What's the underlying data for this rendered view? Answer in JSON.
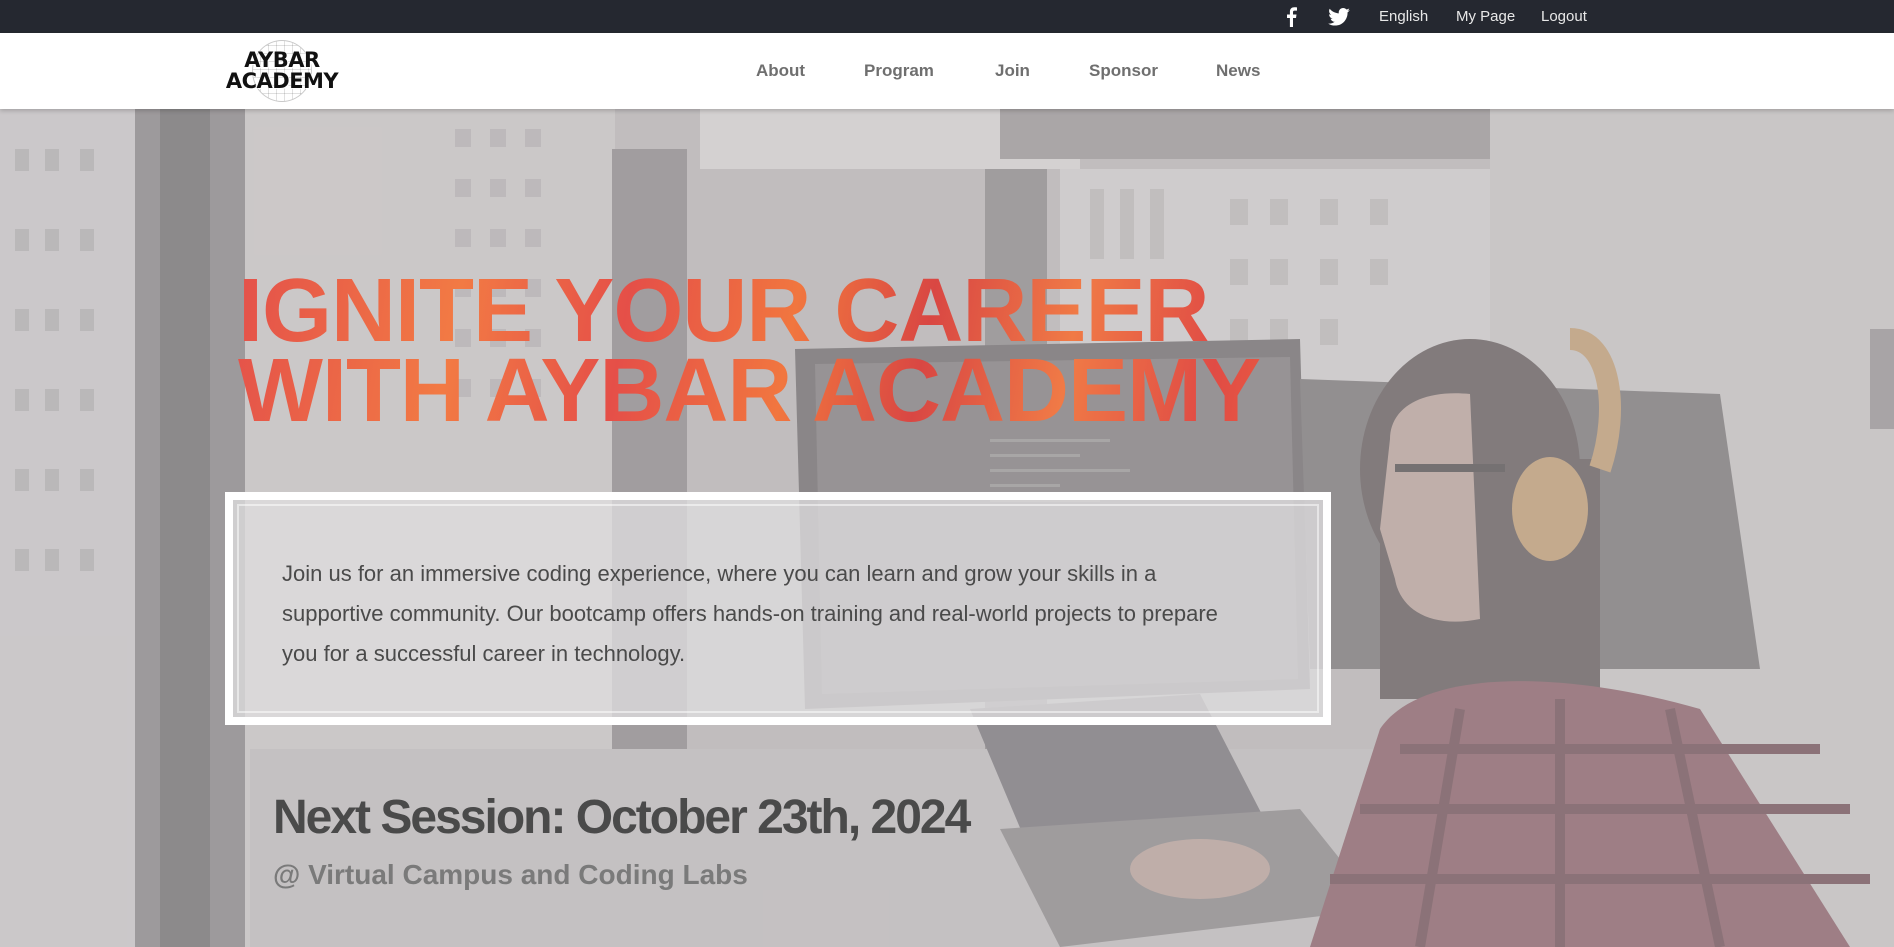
{
  "topbar": {
    "facebook_icon": "facebook-icon",
    "twitter_icon": "twitter-icon",
    "language": "English",
    "my_page": "My Page",
    "logout": "Logout"
  },
  "navbar": {
    "logo_line1": "AYBAR",
    "logo_line2": "ACADEMY",
    "links": [
      "About",
      "Program",
      "Join",
      "Sponsor",
      "News"
    ]
  },
  "hero": {
    "headline_line1": "IGNITE YOUR CAREER",
    "headline_line2": "WITH AYBAR ACADEMY",
    "description": "Join us for an immersive coding experience, where you can learn and grow your skills in a supportive community. Our bootcamp offers hands-on training and real-world projects to prepare you for a successful career in technology.",
    "session_title": "Next Session: October 23th, 2024",
    "session_location": "@ Virtual Campus and Coding Labs"
  },
  "colors": {
    "topbar_bg": "#252830",
    "headline_red": "#e4514a",
    "headline_orange": "#f27a44",
    "text_dark": "#4a4a4a"
  }
}
